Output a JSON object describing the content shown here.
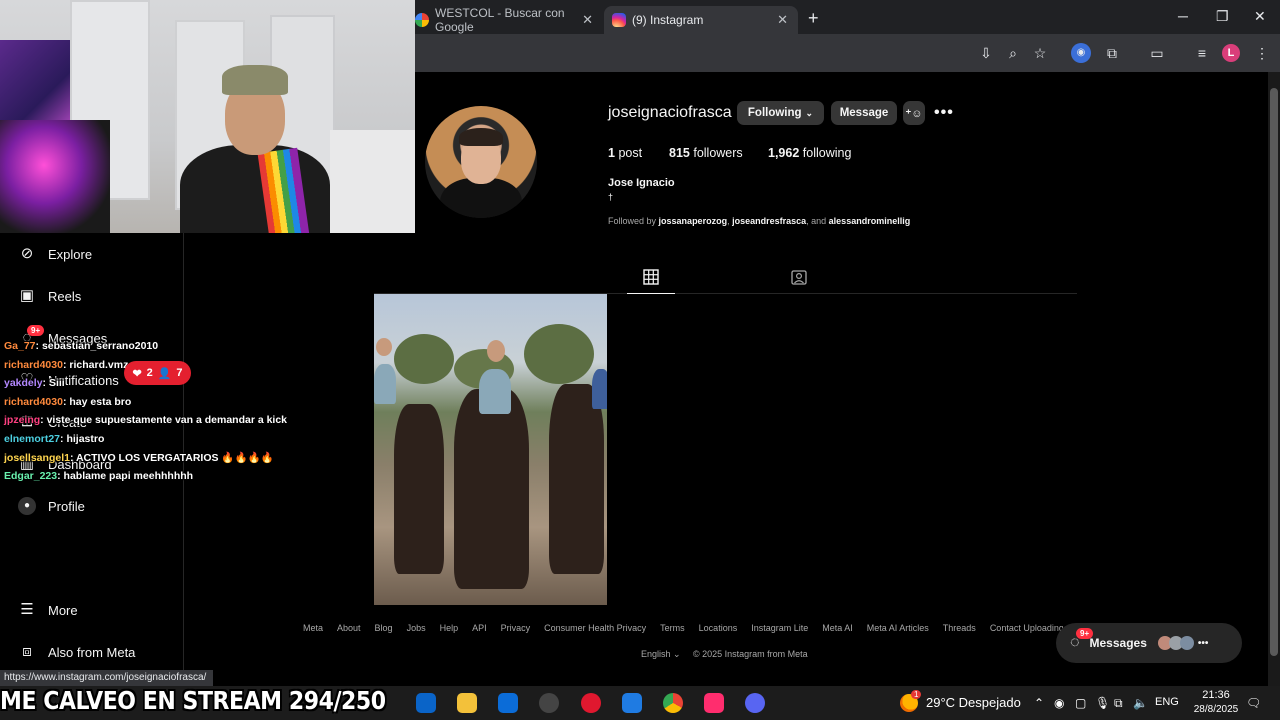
{
  "browser": {
    "tabs": [
      {
        "title": "WESTCOL - Buscar con Google"
      },
      {
        "title": "(9) Instagram"
      }
    ],
    "new_tab": "+",
    "profile_letter": "L"
  },
  "sidebar": {
    "items": [
      {
        "label": "Explore"
      },
      {
        "label": "Reels"
      },
      {
        "label": "Messages",
        "badge": "9+"
      },
      {
        "label": "Notifications"
      },
      {
        "label": "Create"
      },
      {
        "label": "Dashboard"
      },
      {
        "label": "Profile"
      },
      {
        "label": "More"
      },
      {
        "label": "Also from Meta"
      }
    ]
  },
  "chat": {
    "lines": [
      {
        "user": "Ga_77",
        "msg": ": sebastian_serrano2010",
        "color": "#ff8a3d"
      },
      {
        "user": "richard4030",
        "msg": ": richard.vmz",
        "color": "#ff8a3d"
      },
      {
        "user": "yakdely",
        "msg": ": Siii",
        "color": "#b388ff"
      },
      {
        "user": "richard4030",
        "msg": ": hay esta bro",
        "color": "#ff8a3d"
      },
      {
        "user": "jpzeing",
        "msg": ": viste que supuestamente van a demandar a kick",
        "color": "#ff4081"
      },
      {
        "user": "elnemort27",
        "msg": ": hijastro",
        "color": "#4dd0e1"
      },
      {
        "user": "josellsangel1",
        "msg": ": ACTIVO LOS VERGATARIOS 🔥🔥🔥🔥",
        "color": "#ffd54f"
      },
      {
        "user": "Edgar_223",
        "msg": ": hablame papi meehhhhhh",
        "color": "#69f0ae"
      }
    ],
    "likes": "2",
    "viewers": "7"
  },
  "profile": {
    "username": "joseignaciofrasca",
    "following_button": "Following",
    "message_button": "Message",
    "posts_count": "1",
    "posts_label": "post",
    "followers_count": "815",
    "followers_label": "followers",
    "following_count": "1,962",
    "following_label": "following",
    "full_name": "Jose Ignacio",
    "bio": "†",
    "followed_by_prefix": "Followed by",
    "followed_by_1": "jossanaperozog",
    "followed_by_2": "joseandresfrasca",
    "followed_by_and": ", and",
    "followed_by_3": "alessandrominellig"
  },
  "footer": {
    "links": [
      "Meta",
      "About",
      "Blog",
      "Jobs",
      "Help",
      "API",
      "Privacy",
      "Consumer Health Privacy",
      "Terms",
      "Locations",
      "Instagram Lite",
      "Meta AI",
      "Meta AI Articles",
      "Threads",
      "Contact Uploading & Non-Users"
    ],
    "language": "English",
    "copyright": "© 2025 Instagram from Meta"
  },
  "messages_float": {
    "label": "Messages",
    "badge": "9+"
  },
  "status_url": "https://www.instagram.com/joseignaciofrasca/",
  "stream_ticker": "ME CALVEO EN STREAM 294/250",
  "taskbar": {
    "weather": "29°C  Despejado",
    "weather_badge": "1",
    "language": "ENG",
    "time": "21:36",
    "date": "28/8/2025"
  }
}
